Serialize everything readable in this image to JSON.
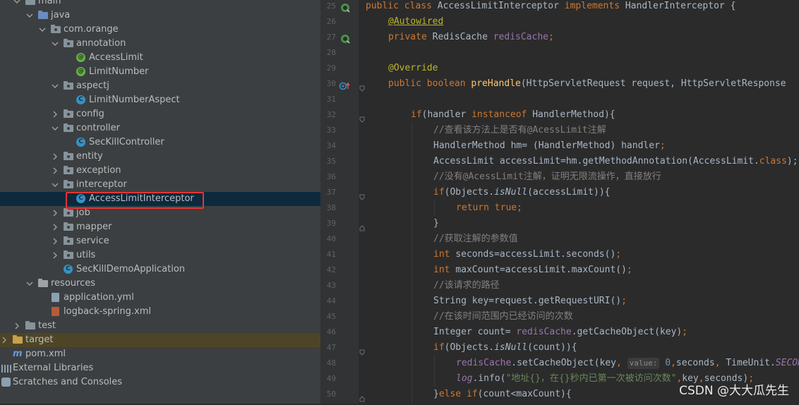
{
  "project_tree": {
    "items": [
      {
        "label": "main"
      },
      {
        "label": "java"
      },
      {
        "label": "com.orange"
      },
      {
        "label": "annotation"
      },
      {
        "label": "AccessLimit"
      },
      {
        "label": "LimitNumber"
      },
      {
        "label": "aspectj"
      },
      {
        "label": "LimitNumberAspect"
      },
      {
        "label": "config"
      },
      {
        "label": "controller"
      },
      {
        "label": "SecKillController"
      },
      {
        "label": "entity"
      },
      {
        "label": "exception"
      },
      {
        "label": "interceptor"
      },
      {
        "label": "AccessLimitInterceptor"
      },
      {
        "label": "job"
      },
      {
        "label": "mapper"
      },
      {
        "label": "service"
      },
      {
        "label": "utils"
      },
      {
        "label": "SecKillDemoApplication"
      },
      {
        "label": "resources"
      },
      {
        "label": "application.yml"
      },
      {
        "label": "logback-spring.xml"
      },
      {
        "label": "test"
      },
      {
        "label": "target"
      },
      {
        "label": "pom.xml"
      },
      {
        "label": "External Libraries"
      },
      {
        "label": "Scratches and Consoles"
      }
    ],
    "selected": "AccessLimitInterceptor"
  },
  "editor": {
    "line_numbers": [
      "25",
      "26",
      "27",
      "28",
      "29",
      "30",
      "31",
      "32",
      "33",
      "34",
      "35",
      "36",
      "37",
      "38",
      "39",
      "40",
      "41",
      "42",
      "43",
      "44",
      "45",
      "46",
      "47",
      "48",
      "49",
      "50"
    ],
    "lines": {
      "l25": {
        "a": "public class ",
        "b": "AccessLimitInterceptor ",
        "c": "implements ",
        "d": "HandlerInterceptor {"
      },
      "l26": {
        "a": "@Autowired"
      },
      "l27": {
        "a": "private ",
        "b": "RedisCache ",
        "c": "redisCache",
        "d": ";"
      },
      "l29": {
        "a": "@Override"
      },
      "l30": {
        "a": "public boolean ",
        "b": "preHandle",
        "c": "(HttpServletRequest request, HttpServletResponse"
      },
      "l32": {
        "a": "if",
        "b": "(handler ",
        "c": "instanceof ",
        "d": "HandlerMethod){"
      },
      "l33": {
        "a": "//查看该方法上是否有@AcessLimit注解"
      },
      "l34": {
        "a": "HandlerMethod hm= (HandlerMethod) handler",
        "b": ";"
      },
      "l35": {
        "a": "AccessLimit accessLimit=hm.getMethodAnnotation(AccessLimit.",
        "b": "class",
        "c": ");"
      },
      "l36": {
        "a": "//没有@AcessLimit注解，证明无限流操作，直接放行"
      },
      "l37": {
        "a": "if",
        "b": "(Objects.",
        "c": "isNull",
        "d": "(accessLimit)){"
      },
      "l38": {
        "a": "return true",
        "b": ";"
      },
      "l39": {
        "a": "}"
      },
      "l40": {
        "a": "//获取注解的参数值"
      },
      "l41": {
        "a": "int ",
        "b": "seconds=accessLimit.seconds()",
        "c": ";"
      },
      "l42": {
        "a": "int ",
        "b": "maxCount=accessLimit.maxCount()",
        "c": ";"
      },
      "l43": {
        "a": "//该请求的路径"
      },
      "l44": {
        "a": "String key=request.getRequestURI()",
        "b": ";"
      },
      "l45": {
        "a": "//在该时间范围内已经访问的次数"
      },
      "l46": {
        "a": "Integer count= ",
        "b": "redisCache",
        "c": ".getCacheObject(key)",
        "d": ";"
      },
      "l47": {
        "a": "if",
        "b": "(Objects.",
        "c": "isNull",
        "d": "(count)){"
      },
      "l48": {
        "a": "redisCache",
        "b": ".setCacheObject(key",
        "c": ", ",
        "hint": "value:",
        "d": " 0",
        "e": ",",
        "f": "seconds",
        "g": ", ",
        "h": "TimeUnit.",
        "i": "SECON"
      },
      "l49": {
        "a": "log",
        "b": ".info(",
        "c": "\"地址{}，在{}秒内已第一次被访问次数\"",
        "d": ",",
        "e": "key",
        "f": ",",
        "g": "seconds)",
        "h": ";"
      },
      "l50": {
        "a": "}",
        "b": "else if",
        "c": "(count<maxCount){"
      }
    }
  },
  "watermark": "CSDN @大大瓜先生",
  "colors": {
    "sidebar_bg": "#3c3f41",
    "editor_bg": "#2b2b2b",
    "selection": "#0d293e",
    "highlight_box": "#e33535",
    "keyword": "#cc7832",
    "annotation": "#bbb529",
    "field": "#9876aa",
    "comment": "#808080",
    "method": "#ffc66d",
    "string": "#6a8759"
  },
  "icons": [
    "chevron-right-icon",
    "chevron-down-icon",
    "folder-icon",
    "package-icon",
    "annotation-class-icon",
    "class-icon",
    "yml-file-icon",
    "xml-file-icon",
    "maven-icon",
    "libraries-icon",
    "scratches-icon",
    "implements-gutter-icon",
    "bean-gutter-icon",
    "override-gutter-icon",
    "fold-icon"
  ]
}
